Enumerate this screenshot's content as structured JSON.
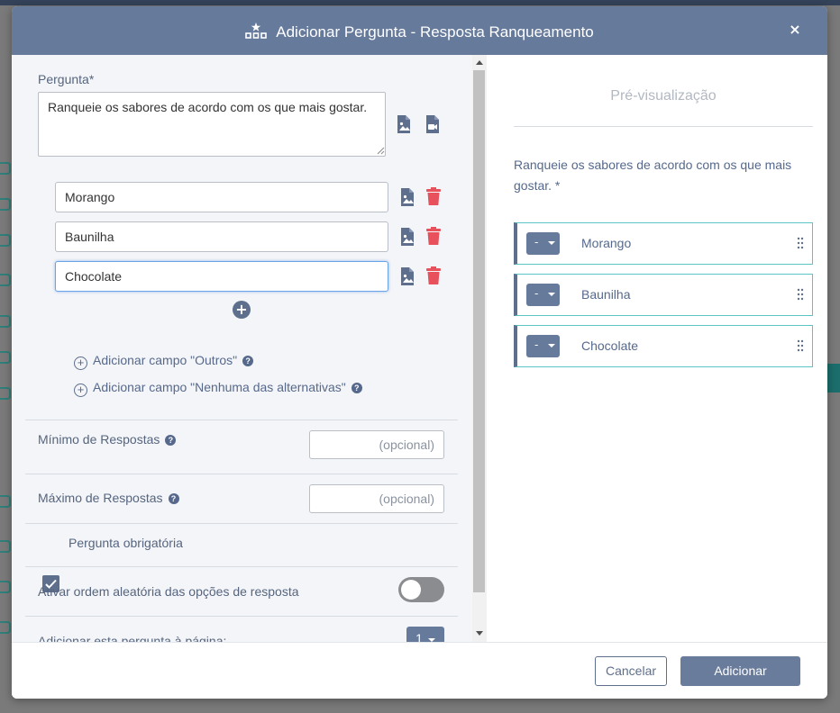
{
  "modal": {
    "title": "Adicionar Pergunta - Resposta Ranqueamento",
    "close_symbol": "×"
  },
  "form": {
    "question_label": "Pergunta*",
    "question_text": "Ranqueie os sabores de acordo com os que mais gostar.",
    "options": [
      {
        "value": "Morango"
      },
      {
        "value": "Baunilha"
      },
      {
        "value": "Chocolate"
      }
    ],
    "add_option_symbol": "+",
    "add_other_label": "Adicionar campo \"Outros\"",
    "add_none_label": "Adicionar campo \"Nenhuma das alternativas\"",
    "min_label": "Mínimo de Respostas",
    "min_placeholder": "(opcional)",
    "max_label": "Máximo de Respostas",
    "max_placeholder": "(opcional)",
    "required_label": "Pergunta obrigatória",
    "required_checked": true,
    "random_order_label": "Ativar ordem aleatória das opções de resposta",
    "random_order_on": false,
    "add_to_page_label": "Adicionar esta pergunta à página:",
    "page_value": "1"
  },
  "preview": {
    "title": "Pré-visualização",
    "question": "Ranqueie os sabores de acordo com os que mais gostar. *",
    "rank_placeholder": "-",
    "items": [
      {
        "label": "Morango"
      },
      {
        "label": "Baunilha"
      },
      {
        "label": "Chocolate"
      }
    ]
  },
  "footer": {
    "cancel_label": "Cancelar",
    "add_label": "Adicionar"
  },
  "colors": {
    "header": "#667a9c",
    "accent": "#5e6f8d",
    "delete": "#e8505b",
    "preview_border": "#5cc4c4"
  },
  "icons": [
    "ranking-icon",
    "close-icon",
    "image-icon",
    "video-icon",
    "trash-icon",
    "add-icon",
    "help-icon",
    "drag-handle-icon",
    "checkmark-icon"
  ]
}
